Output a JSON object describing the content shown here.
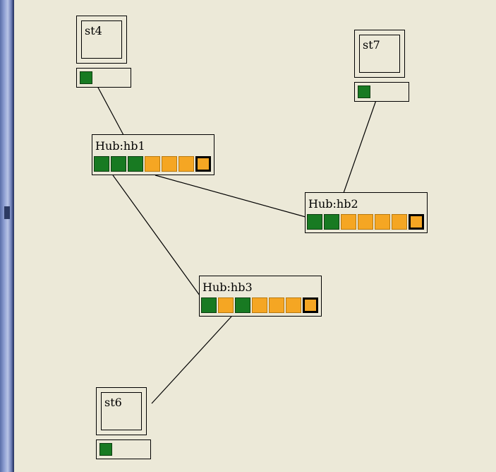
{
  "diagram": {
    "stations": [
      {
        "id": "st4",
        "label": "st4",
        "ports": [
          "used"
        ]
      },
      {
        "id": "st7",
        "label": "st7",
        "ports": [
          "used"
        ]
      },
      {
        "id": "st6",
        "label": "st6",
        "ports": [
          "used"
        ]
      }
    ],
    "hubs": [
      {
        "id": "hb1",
        "label": "Hub:hb1",
        "ports": [
          "used",
          "used",
          "used",
          "free",
          "free",
          "free",
          "selected"
        ]
      },
      {
        "id": "hb2",
        "label": "Hub:hb2",
        "ports": [
          "used",
          "used",
          "free",
          "free",
          "free",
          "free",
          "selected"
        ]
      },
      {
        "id": "hb3",
        "label": "Hub:hb3",
        "ports": [
          "used",
          "free",
          "used",
          "free",
          "free",
          "free",
          "selected"
        ]
      }
    ],
    "links": [
      {
        "from": "st4",
        "to": "hb1"
      },
      {
        "from": "st7",
        "to": "hb2"
      },
      {
        "from": "hb1",
        "to": "hb2"
      },
      {
        "from": "hb1",
        "to": "hb3"
      },
      {
        "from": "hb3",
        "to": "st6"
      }
    ],
    "colors": {
      "canvas": "#ece9d8",
      "port_used": "#187a22",
      "port_free": "#f5a623",
      "link": "#000000"
    }
  }
}
